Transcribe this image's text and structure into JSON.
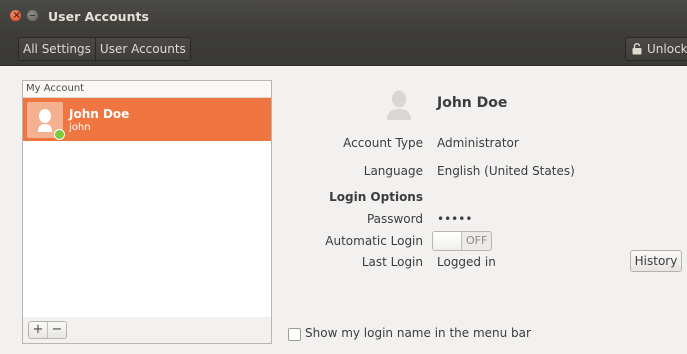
{
  "window": {
    "title": "User Accounts"
  },
  "toolbar": {
    "breadcrumbs": [
      "All Settings",
      "User Accounts"
    ],
    "unlock_label": "Unlock"
  },
  "user_list": {
    "header": "My Account",
    "users": [
      {
        "name": "John Doe",
        "login": "john",
        "online": true
      }
    ],
    "add_label": "+",
    "remove_label": "−"
  },
  "details": {
    "name": "John Doe",
    "account_type_label": "Account Type",
    "account_type_value": "Administrator",
    "language_label": "Language",
    "language_value": "English (United States)",
    "login_options_label": "Login Options",
    "password_label": "Password",
    "password_value": "•••••",
    "auto_login_label": "Automatic Login",
    "auto_login_state": "OFF",
    "last_login_label": "Last Login",
    "last_login_value": "Logged in",
    "history_label": "History",
    "show_login_name_label": "Show my login name in the menu bar"
  },
  "colors": {
    "accent": "#ef7641",
    "online": "#7ec93c",
    "titlebar": "#3e3d39",
    "background": "#f2f1f0"
  },
  "icons": [
    "close-icon",
    "minimize-icon",
    "lock-icon",
    "user-avatar-icon"
  ]
}
